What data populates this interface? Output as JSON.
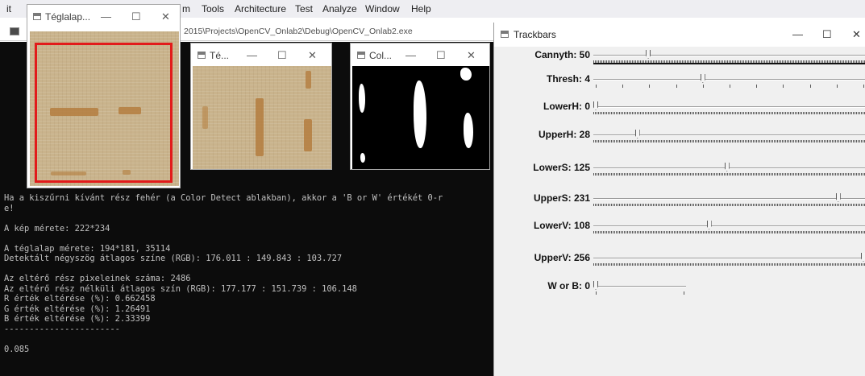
{
  "vs": {
    "menu": [
      "it",
      "m",
      "Tools",
      "Architecture",
      "Test",
      "Analyze",
      "Window",
      "Help"
    ],
    "path": "2015\\Projects\\OpenCV_Onlab2\\Debug\\OpenCV_Onlab2.exe"
  },
  "console": {
    "lines": [
      "Ha a kiszűrni kívánt rész fehér (a Color Detect ablakban), akkor a 'B or W' értékét 0-r",
      "e!",
      "",
      "A kép mérete: 222*234",
      "",
      "A téglalap mérete: 194*181, 35114",
      "Detektált négyszög átlagos színe (RGB): 176.011 : 149.843 : 103.727",
      "",
      "Az eltérő rész pixeleinek száma: 2486",
      "Az eltérő rész nélküli átlagos szín (RGB): 177.177 : 151.739 : 106.148",
      "R érték eltérése (%): 0.662458",
      "G érték eltérése (%): 1.26491",
      "B érték eltérése (%): 2.33399",
      "-----------------------",
      "",
      "0.085"
    ]
  },
  "windows": {
    "win1": {
      "title": "Téglalap..."
    },
    "win2": {
      "title": "Té..."
    },
    "win3": {
      "title": "Col..."
    },
    "trackbars": {
      "title": "Trackbars"
    }
  },
  "window_controls": {
    "minimize": "—",
    "maximize": "☐",
    "close": "✕"
  },
  "trackbars": [
    {
      "label": "Cannyth: 50",
      "value": 50,
      "max": 255,
      "ticks": "dense"
    },
    {
      "label": "Thresh: 4",
      "value": 4,
      "max": 10,
      "ticks": "sparse"
    },
    {
      "label": "LowerH: 0",
      "value": 0,
      "max": 180,
      "ticks": "dense"
    },
    {
      "label": "UpperH: 28",
      "value": 28,
      "max": 180,
      "ticks": "dense"
    },
    {
      "label": "LowerS: 125",
      "value": 125,
      "max": 255,
      "ticks": "dense"
    },
    {
      "label": "UpperS: 231",
      "value": 231,
      "max": 255,
      "ticks": "dense"
    },
    {
      "label": "LowerV: 108",
      "value": 108,
      "max": 255,
      "ticks": "dense"
    },
    {
      "label": "UpperV: 256",
      "value": 256,
      "max": 256,
      "ticks": "dense"
    },
    {
      "label": "W or B: 0",
      "value": 0,
      "max": 1,
      "ticks": "sparse"
    }
  ],
  "colors": {
    "highlight_rect": "#e21b1b",
    "console_bg": "#0c0c0c",
    "console_fg": "#c0c0c0"
  },
  "icons": [
    "window-app-icon",
    "minimize-icon",
    "maximize-icon",
    "close-icon"
  ]
}
